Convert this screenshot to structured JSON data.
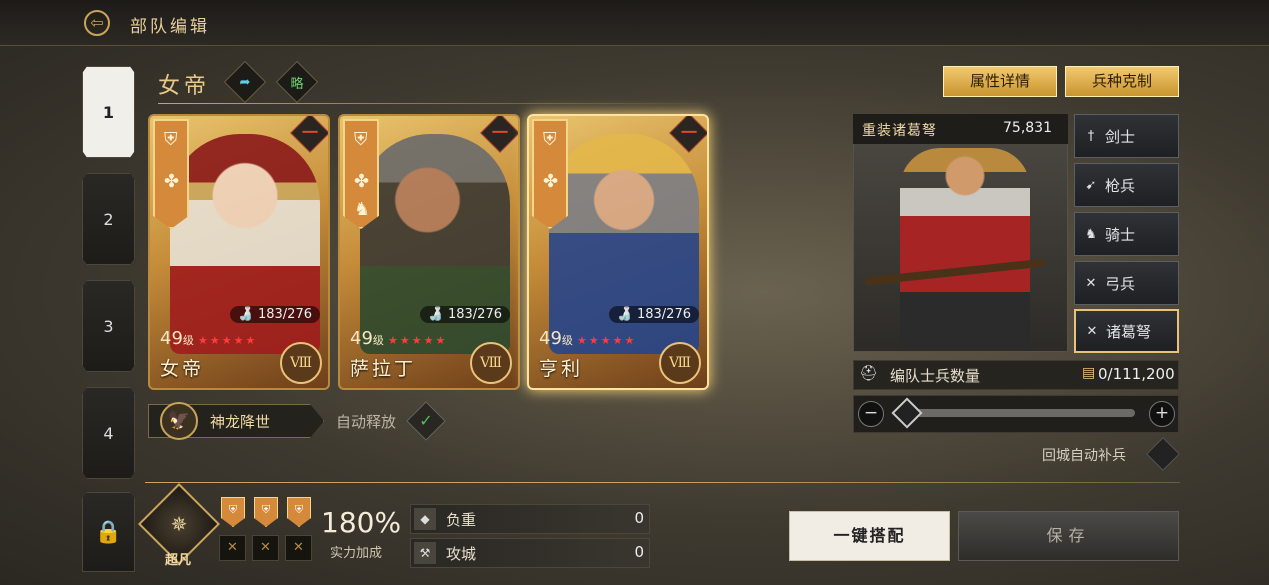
{
  "header": {
    "title": "部队编辑",
    "back_icon": "arrow-left-icon"
  },
  "tabs": [
    "1",
    "2",
    "3",
    "4"
  ],
  "troop": {
    "name": "女帝",
    "share_icon": "share-arrow-icon",
    "strategy_badge": "略"
  },
  "heroes": [
    {
      "name": "女帝",
      "stamina": "183/276",
      "level": "49",
      "level_unit": "级",
      "stars": 5,
      "rank": "Ⅷ",
      "remove_label": "一"
    },
    {
      "name": "萨拉丁",
      "stamina": "183/276",
      "level": "49",
      "level_unit": "级",
      "stars": 5,
      "rank": "Ⅷ",
      "remove_label": "一"
    },
    {
      "name": "亨利",
      "stamina": "183/276",
      "level": "49",
      "level_unit": "级",
      "stars": 5,
      "rank": "Ⅷ",
      "remove_label": "一"
    }
  ],
  "skill": {
    "name": "神龙降世",
    "auto_label": "自动释放",
    "auto_enabled": true
  },
  "right": {
    "btn_attributes": "属性详情",
    "btn_counter": "兵种克制",
    "unit_name": "重装诸葛弩",
    "unit_count": "75,831",
    "unit_types": [
      {
        "label": "剑士",
        "icon": "sword-icon"
      },
      {
        "label": "枪兵",
        "icon": "spear-icon"
      },
      {
        "label": "骑士",
        "icon": "horse-icon"
      },
      {
        "label": "弓兵",
        "icon": "bow-icon"
      },
      {
        "label": "诸葛弩",
        "icon": "crossbow-icon",
        "selected": true
      }
    ],
    "soldier_label": "编队士兵数量",
    "soldier_value": "0/111,200",
    "refill_label": "回城自动补兵"
  },
  "bottom": {
    "rank_label": "超凡",
    "bonus_pct": "180%",
    "bonus_label": "实力加成",
    "stats": [
      {
        "label": "负重",
        "value": "0",
        "icon": "load-icon"
      },
      {
        "label": "攻城",
        "value": "0",
        "icon": "siege-icon"
      }
    ],
    "btn_auto": "一键搭配",
    "btn_save": "保存"
  },
  "colors": {
    "accent_gold": "#c9a55a",
    "star_red": "#ff3b3b",
    "check_green": "#47c45a"
  }
}
